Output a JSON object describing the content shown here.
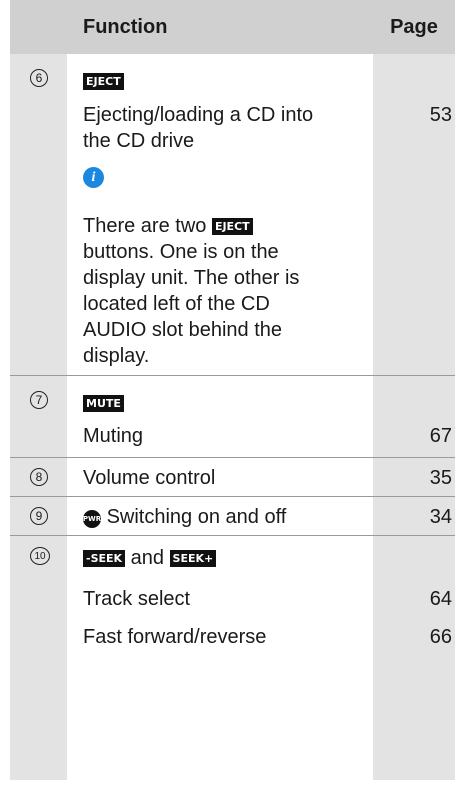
{
  "header": {
    "function": "Function",
    "page": "Page"
  },
  "sections": [
    {
      "num": "6",
      "button": "EJECT",
      "item": [
        "Ejecting/loading a CD into",
        "the CD drive"
      ],
      "item_page": "53",
      "note": {
        "icon": "info-icon",
        "line1_before": "There are two",
        "line1_button": "EJECT",
        "lines": [
          "buttons. One is on the",
          "display unit. The other is",
          "located left of the CD",
          "AUDIO slot behind the",
          "display."
        ]
      }
    },
    {
      "num": "7",
      "button": "MUTE",
      "item": "Muting",
      "item_page": "67"
    },
    {
      "num": "8",
      "label": "Volume control",
      "page": "35"
    },
    {
      "num": "9",
      "icon_text": "PWR",
      "label": "Switching on and off",
      "page": "34"
    },
    {
      "num": "10",
      "button1": "-SEEK",
      "joiner": "and",
      "button2": "SEEK+",
      "items": [
        {
          "label": "Track select",
          "page": "64"
        },
        {
          "label": "Fast forward/reverse",
          "page": "66"
        }
      ]
    }
  ]
}
